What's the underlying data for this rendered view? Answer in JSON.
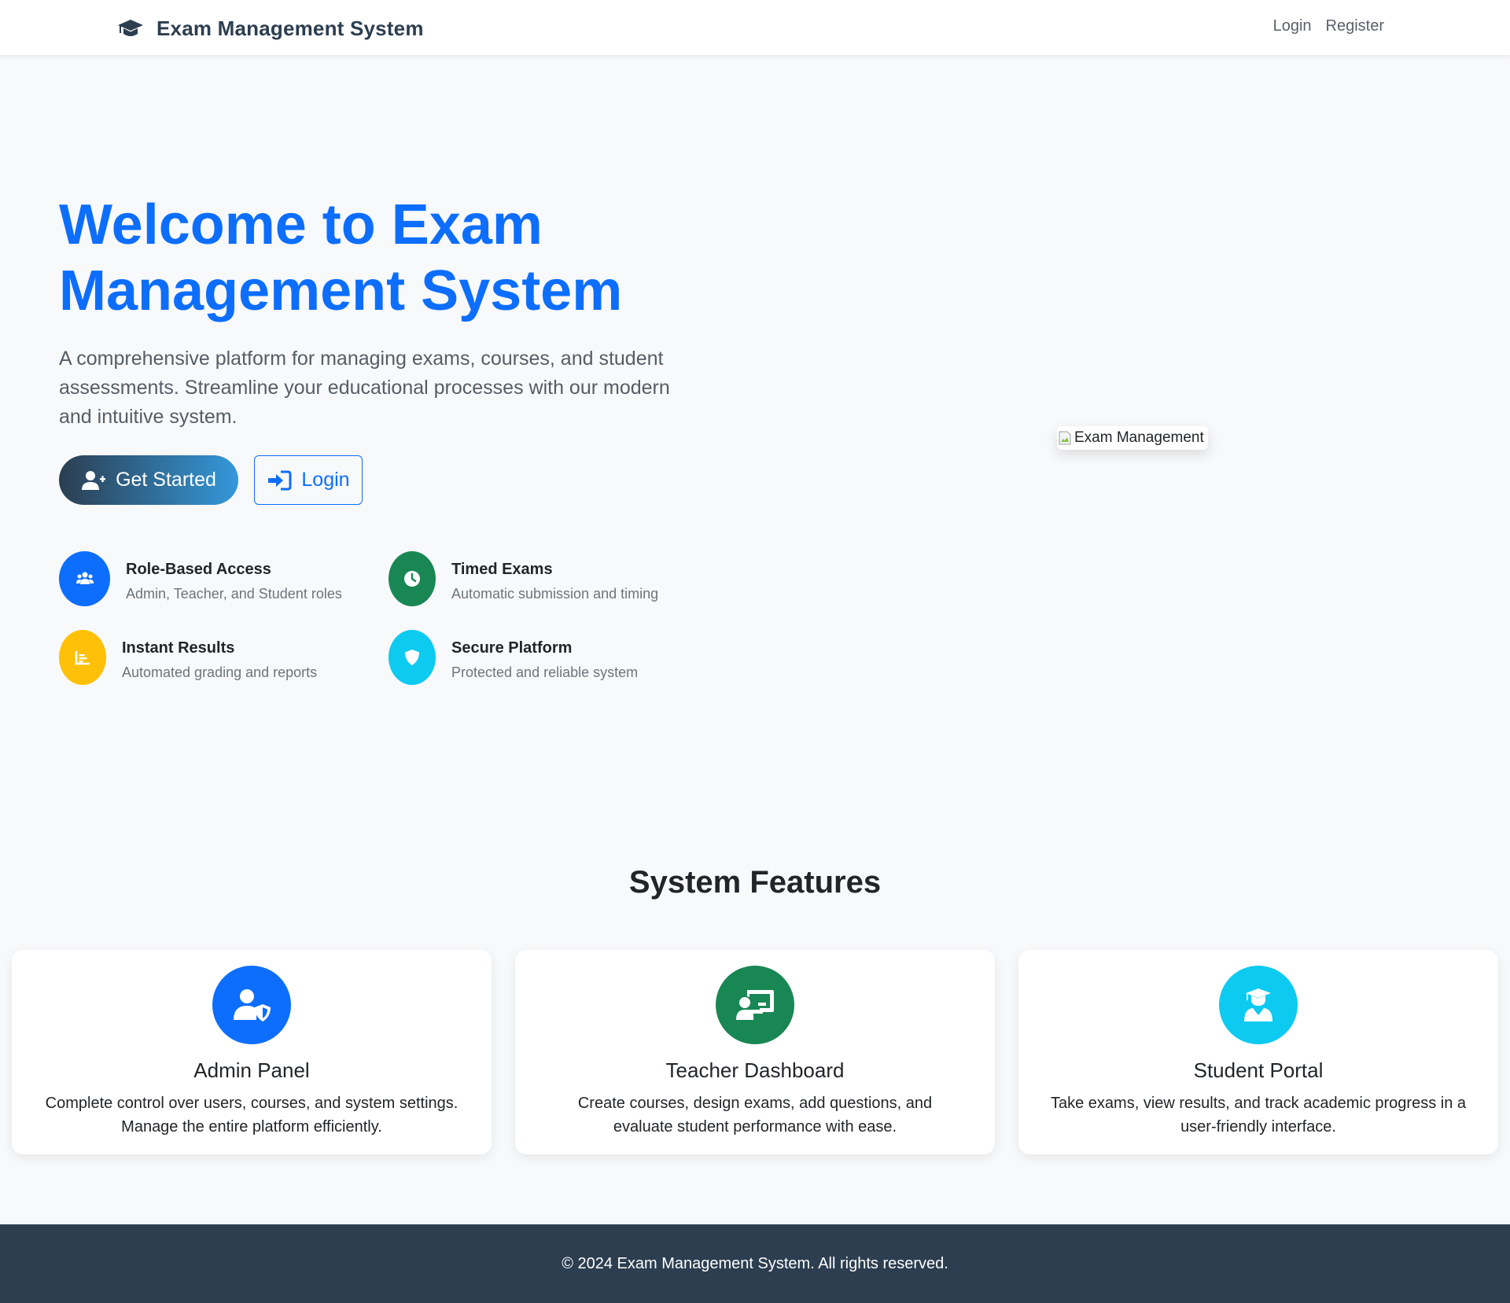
{
  "navbar": {
    "brand": "Exam Management System",
    "brand_icon": "graduation-cap-icon",
    "links": [
      "Login",
      "Register"
    ]
  },
  "hero": {
    "title": "Welcome to Exam Management System",
    "subtitle": "A comprehensive platform for managing exams, courses, and student assessments. Streamline your educational processes with our modern and intuitive system.",
    "primary_button": "Get Started",
    "primary_button_icon": "user-plus-icon",
    "secondary_button": "Login",
    "secondary_button_icon": "sign-in-icon",
    "image_alt": "Exam Management",
    "mini_features": [
      {
        "title": "Role-Based Access",
        "desc": "Admin, Teacher, and Student roles",
        "icon": "users-icon",
        "color": "#0d6efd"
      },
      {
        "title": "Timed Exams",
        "desc": "Automatic submission and timing",
        "icon": "clock-icon",
        "color": "#198754"
      },
      {
        "title": "Instant Results",
        "desc": "Automated grading and reports",
        "icon": "chart-icon",
        "color": "#ffc107"
      },
      {
        "title": "Secure Platform",
        "desc": "Protected and reliable system",
        "icon": "shield-icon",
        "color": "#0dcaf0"
      }
    ]
  },
  "features": {
    "title": "System Features",
    "cards": [
      {
        "title": "Admin Panel",
        "desc": "Complete control over users, courses, and system settings. Manage the entire platform efficiently.",
        "icon": "user-shield-icon",
        "color": "#0d6efd"
      },
      {
        "title": "Teacher Dashboard",
        "desc": "Create courses, design exams, add questions, and evaluate student performance with ease.",
        "icon": "chalkboard-teacher-icon",
        "color": "#198754"
      },
      {
        "title": "Student Portal",
        "desc": "Take exams, view results, and track academic progress in a user-friendly interface.",
        "icon": "user-graduate-icon",
        "color": "#0dcaf0"
      }
    ]
  },
  "footer": {
    "text": "© 2024 Exam Management System. All rights reserved."
  }
}
